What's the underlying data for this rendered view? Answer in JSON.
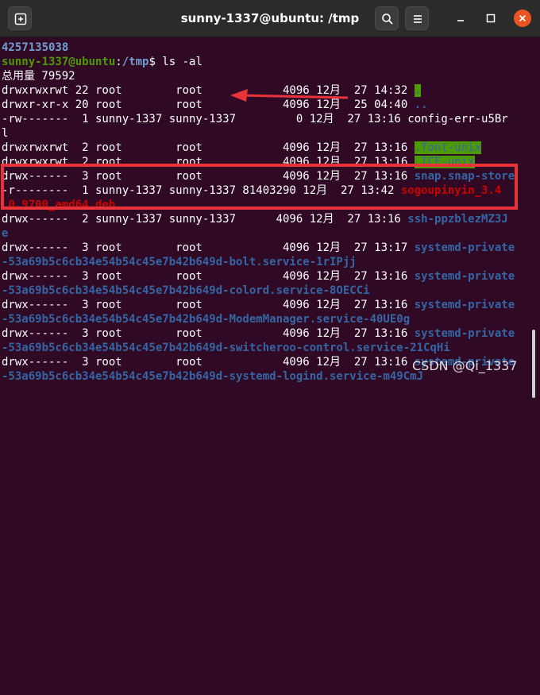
{
  "window": {
    "title": "sunny-1337@ubuntu: /tmp"
  },
  "terminal": {
    "lines": [
      "4257135038",
      "sunny-1337@ubuntu",
      ":",
      "/tmp",
      "$ ls -al",
      "总用量 79592",
      "drwxrwxrwt 22 root        root            4096 12月  27 14:32 ",
      ".",
      "drwxr-xr-x 20 root        root            4096 12月  25 04:40 ",
      "..",
      "-rw-------  1 sunny-1337 sunny-1337         0 12月  27 13:16 config-err-u5Br",
      "l",
      "drwxrwxrwt  2 root        root            4096 12月  27 13:16 ",
      ".font-unix",
      "drwxrwxrwt  2 root        root            4096 12月  27 13:16 ",
      ".ICE-unix",
      "drwx------  3 root        root            4096 12月  27 13:16 ",
      "snap.snap-store",
      "-r--------  1 sunny-1337 sunny-1337 81403290 12月  27 13:42 ",
      "sogoupinyin_3.4",
      ".0.9700_amd64.deb",
      "drwx------  2 sunny-1337 sunny-1337      4096 12月  27 13:16 ",
      "ssh-ppzblezMZ3J",
      "e",
      "drwx------  3 root        root            4096 12月  27 13:17 ",
      "systemd-private",
      "-53a69b5c6cb34e54b54c45e7b42b649d-bolt.service-1rIPjj",
      "drwx------  3 root        root            4096 12月  27 13:16 ",
      "systemd-private",
      "-53a69b5c6cb34e54b54c45e7b42b649d-colord.service-8OECCi",
      "drwx------  3 root        root            4096 12月  27 13:16 ",
      "systemd-private",
      "-53a69b5c6cb34e54b54c45e7b42b649d-ModemManager.service-40UE0g",
      "drwx------  3 root        root            4096 12月  27 13:16 ",
      "systemd-private",
      "-53a69b5c6cb34e54b54c45e7b42b649d-switcheroo-control.service-21CqHi",
      "drwx------  3 root        root            4096 12月  27 13:16 ",
      "systemd-private",
      "-53a69b5c6cb34e54b54c45e7b42b649d-systemd-logind.service-m49CmJ"
    ]
  },
  "watermark": "CSDN @Qi_1337",
  "icons": {
    "new_tab": "new-tab-icon",
    "search": "search-icon",
    "menu": "hamburger-menu-icon",
    "minimize": "minimize-icon",
    "maximize": "maximize-icon",
    "close": "close-icon"
  },
  "colors": {
    "terminal_bg": "#300a24",
    "prompt_green": "#4e9a06",
    "dir_blue": "#3465a4",
    "archive_red": "#cc0000",
    "highlight_box": "#e8333a",
    "close_orange": "#e95420"
  }
}
